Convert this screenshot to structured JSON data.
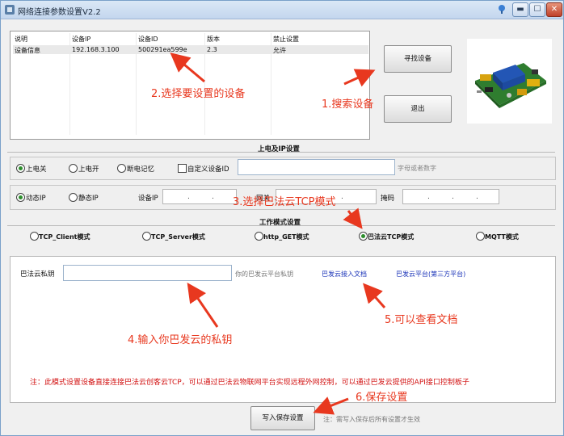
{
  "window": {
    "title": "网络连接参数设置V2.2",
    "controls": {
      "minimize": "▬",
      "maximize": "☐",
      "close": "✕"
    }
  },
  "device_list": {
    "columns": [
      "说明",
      "设备IP",
      "设备ID",
      "版本",
      "禁止设置"
    ],
    "rows": [
      {
        "desc": "设备信息",
        "ip": "192.168.3.100",
        "id": "500291ea599e",
        "version": "2.3",
        "forbid": "允许"
      }
    ]
  },
  "buttons": {
    "search": "寻找设备",
    "exit": "退出",
    "write_save": "写入保存设置"
  },
  "power_section": {
    "title": "上电及IP设置",
    "options": [
      "上电关",
      "上电开",
      "断电记忆"
    ],
    "selected": "上电关",
    "custom_id_label": "自定义设备ID",
    "custom_id_value": "",
    "custom_id_hint": "字母或者数字"
  },
  "ip_section": {
    "options": [
      "动态IP",
      "静态IP"
    ],
    "selected": "动态IP",
    "device_ip_label": "设备IP",
    "gateway_label": "网关",
    "mask_label": "掩码",
    "dot": "."
  },
  "mode_section": {
    "title": "工作模式设置",
    "options": [
      "TCP_Client模式",
      "TCP_Server模式",
      "http_GET模式",
      "巴法云TCP模式",
      "MQTT模式"
    ],
    "selected": "巴法云TCP模式"
  },
  "bafa": {
    "key_label": "巴法云私钥",
    "key_value": "",
    "key_hint": "你的巴发云平台私钥",
    "doc_link": "巴发云接入文档",
    "platform_link": "巴发云平台(第三方平台)",
    "note": "注：此模式设置设备直接连接巴法云创客云TCP，可以通过巴法云物联网平台实现远程外网控制，可以通过巴发云提供的API接口控制板子"
  },
  "save_hint": "注：需写入保存后所有设置才生效",
  "annotations": {
    "a1": "1.搜索设备",
    "a2": "2.选择要设置的设备",
    "a3": "3.选择巴法云TCP模式",
    "a4": "4.输入你巴发云的私钥",
    "a5": "5.可以查看文档",
    "a6": "6.保存设置"
  },
  "colors": {
    "annotation": "#e8381f",
    "note": "#d21212",
    "link": "#1a33b8"
  }
}
